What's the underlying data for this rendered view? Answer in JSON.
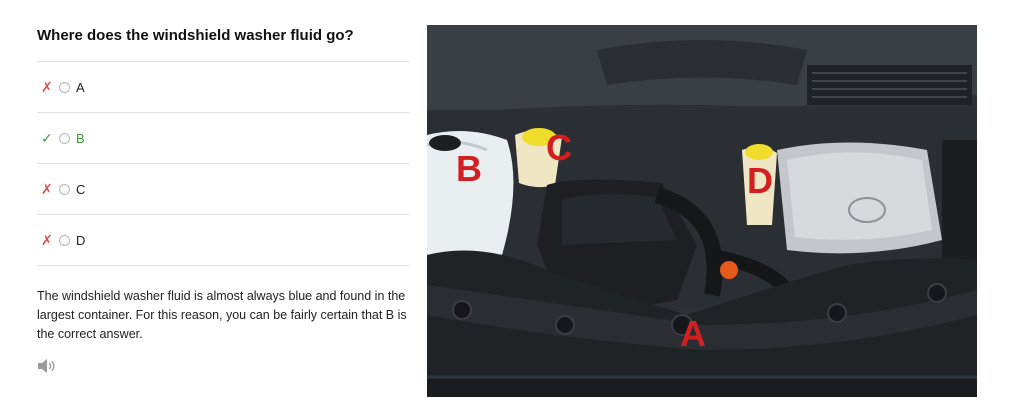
{
  "question": "Where does the windshield washer fluid go?",
  "options": [
    {
      "label": "A",
      "mark": "✗",
      "status": "wrong"
    },
    {
      "label": "B",
      "mark": "✓",
      "status": "correct"
    },
    {
      "label": "C",
      "mark": "✗",
      "status": "wrong"
    },
    {
      "label": "D",
      "mark": "✗",
      "status": "wrong"
    }
  ],
  "explanation": "The windshield washer fluid is almost always blue and found in the largest container. For this reason, you can be fairly certain that B is the correct answer.",
  "audio_icon": "speaker-icon",
  "image": {
    "labels": {
      "a": "A",
      "b": "B",
      "c": "C",
      "d": "D"
    },
    "label_color": "#d21f1f"
  },
  "colors": {
    "correct": "#3c9a3c",
    "wrong": "#d9534f",
    "divider": "#e2e2e2"
  }
}
